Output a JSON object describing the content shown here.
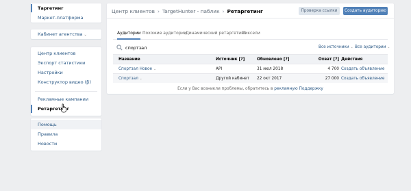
{
  "sidebar": {
    "group1": [
      {
        "label": "Таргетинг",
        "active": true
      },
      {
        "label": "Маркет-платформа"
      }
    ],
    "group2": [
      {
        "label": "Кабинет агентства",
        "arrow": "⌄"
      }
    ],
    "group3": [
      {
        "label": "Центр клиентов"
      },
      {
        "label": "Экспорт статистики"
      },
      {
        "label": "Настройки"
      },
      {
        "label": "Конструктор видео (β)"
      },
      {
        "label": "Рекламные кампании"
      },
      {
        "label": "Ретаргетинг",
        "active": true
      }
    ],
    "group4": [
      {
        "label": "Помощь"
      },
      {
        "label": "Правила"
      },
      {
        "label": "Новости"
      }
    ]
  },
  "header": {
    "breadcrumbs": [
      "Центр клиентов",
      "TargetHunter - паблик",
      "Ретаргетинг"
    ],
    "separator": "›",
    "check_links_label": "Проверка ссылки",
    "create_audience_label": "Создать аудиторию"
  },
  "tabs": [
    {
      "label": "Аудитории",
      "active": true
    },
    {
      "label": "Похожие аудитории"
    },
    {
      "label": "Динамический ретаргетинг"
    },
    {
      "label": "Пиксели"
    }
  ],
  "search": {
    "value": "спортзал",
    "placeholder": "Поиск"
  },
  "filters": {
    "sources_label": "Все источники",
    "audiences_label": "Все аудитории",
    "arrow": "⌄"
  },
  "table": {
    "headers": {
      "name": "Название",
      "source": "Источник [?]",
      "updated": "Обновлено [?]",
      "reach": "Охват [?]",
      "actions": "Действия"
    },
    "rows": [
      {
        "name": "Спортзал Новое",
        "source": "API",
        "updated": "31 июл 2018",
        "reach": "4 700",
        "action": "Создать объявление"
      },
      {
        "name": "Спортзал",
        "source": "Другой кабинет",
        "updated": "22 окт 2017",
        "reach": "27 000",
        "action": "Создать объявление"
      }
    ],
    "row_arrow": "⌄"
  },
  "footer": {
    "text": "Если у Вас возникли проблемы, обратитесь в ",
    "link": "рекламную Поддержку"
  },
  "colors": {
    "accent": "#5181b8",
    "link": "#2a5885",
    "background": "#edeef0"
  }
}
